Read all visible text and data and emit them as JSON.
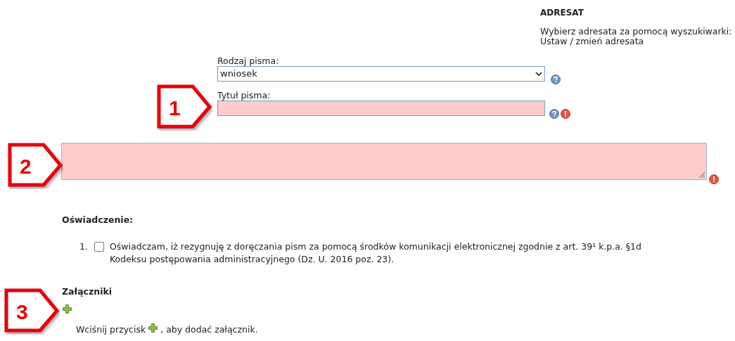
{
  "recipient": {
    "heading": "ADRESAT",
    "instruction": "Wybierz adresata za pomocą wyszukiwarki:",
    "link": "Ustaw / zmień adresata"
  },
  "letter_type": {
    "label": "Rodzaj pisma:",
    "value": "wniosek"
  },
  "letter_title": {
    "label": "Tytuł pisma:",
    "invalid": true
  },
  "content": {
    "invalid": true
  },
  "declaration": {
    "heading": "Oświadczenie:",
    "items": [
      {
        "number": "1.",
        "text": "Oświadczam, iż rezygnuję z doręczania pism za pomocą środków komunikacji elektronicznej zgodnie z art. 39¹ k.p.a. §1d Kodeksu postępowania administracyjnego (Dz. U. 2016 poz. 23).",
        "checked": false
      }
    ]
  },
  "attachments": {
    "heading": "Załączniki",
    "hint_before": "Wciśnij przycisk",
    "hint_after": ", aby dodać załącznik."
  },
  "callouts": [
    "1",
    "2",
    "3"
  ]
}
